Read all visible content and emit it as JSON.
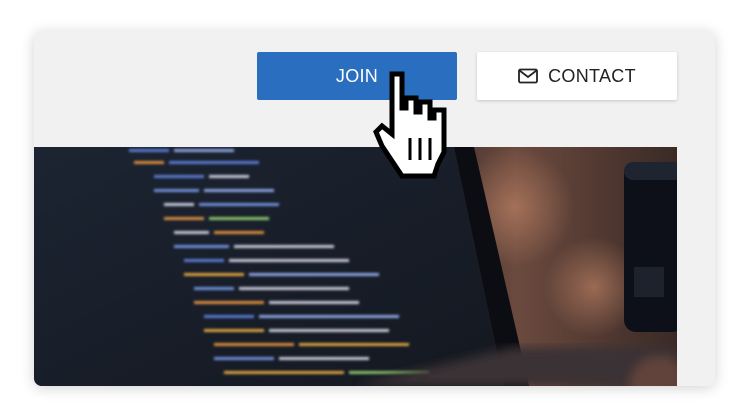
{
  "actions": {
    "join_label": "JOIN",
    "contact_label": "CONTACT",
    "contact_icon": "envelope-icon",
    "cursor_icon": "hand-pointer-icon"
  },
  "colors": {
    "primary": "#2a6ebf",
    "card_background": "#f1f1f1",
    "contact_background": "#ffffff"
  }
}
